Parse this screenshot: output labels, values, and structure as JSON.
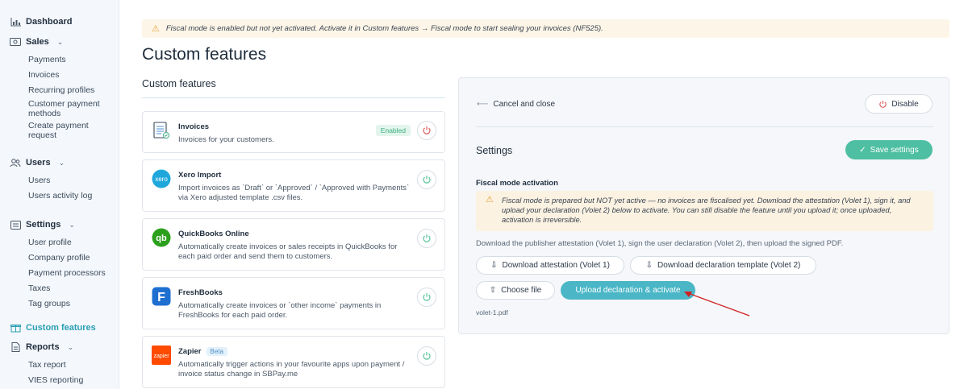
{
  "sidebar": {
    "dashboard": "Dashboard",
    "sales": {
      "label": "Sales",
      "items": [
        "Payments",
        "Invoices",
        "Recurring profiles",
        "Customer payment methods",
        "Create payment request"
      ]
    },
    "users": {
      "label": "Users",
      "items": [
        "Users",
        "Users activity log"
      ]
    },
    "settings": {
      "label": "Settings",
      "items": [
        "User profile",
        "Company profile",
        "Payment processors",
        "Taxes",
        "Tag groups"
      ]
    },
    "custom_features": "Custom features",
    "reports": {
      "label": "Reports",
      "items": [
        "Tax report",
        "VIES reporting"
      ]
    }
  },
  "banner": "Fiscal mode is enabled but not yet activated. Activate it in Custom features → Fiscal mode to start sealing your invoices (NF525).",
  "page_title": "Custom features",
  "section_title": "Custom features",
  "cards": [
    {
      "name": "Invoices",
      "desc": "Invoices for your customers.",
      "badge": "Enabled",
      "icon": "invoice-icon"
    },
    {
      "name": "Xero Import",
      "desc": "Import invoices as `Draft` or `Approved` / `Approved with Payments` via Xero adjusted template .csv files.",
      "icon": "xero-logo",
      "logo_text": "xero"
    },
    {
      "name": "QuickBooks Online",
      "desc": "Automatically create invoices or sales receipts in QuickBooks for each paid order and send them to customers.",
      "icon": "quickbooks-logo",
      "logo_text": "qb"
    },
    {
      "name": "FreshBooks",
      "desc": "Automatically create invoices or `other income` payments in FreshBooks for each paid order.",
      "icon": "freshbooks-logo",
      "logo_text": "F"
    },
    {
      "name": "Zapier",
      "badge": "Beta",
      "desc": "Automatically trigger actions in your favourite apps upon payment / invoice status change in SBPay.me",
      "icon": "zapier-logo",
      "logo_text": "zapier"
    }
  ],
  "panel": {
    "cancel": "Cancel and close",
    "disable": "Disable",
    "settings_title": "Settings",
    "save": "Save settings",
    "fm_title": "Fiscal mode activation",
    "fm_warning": "Fiscal mode is prepared but NOT yet active — no invoices are fiscalised yet. Download the attestation (Volet 1), sign it, and upload your declaration (Volet 2) below to activate. You can still disable the feature until you upload it; once uploaded, activation is irreversible.",
    "help": "Download the publisher attestation (Volet 1), sign the user declaration (Volet 2), then upload the signed PDF.",
    "download_attestation": "Download attestation (Volet 1)",
    "download_declaration": "Download declaration template (Volet 2)",
    "choose_file": "Choose file",
    "upload": "Upload declaration & activate",
    "filename": "volet-1.pdf"
  },
  "colors": {
    "accent": "#2a9fb5",
    "save": "#4fbfa3",
    "upload": "#4ab6c6",
    "warning_bg": "#fbf2e2",
    "danger": "#e05a5a",
    "arrow": "#d22020"
  }
}
